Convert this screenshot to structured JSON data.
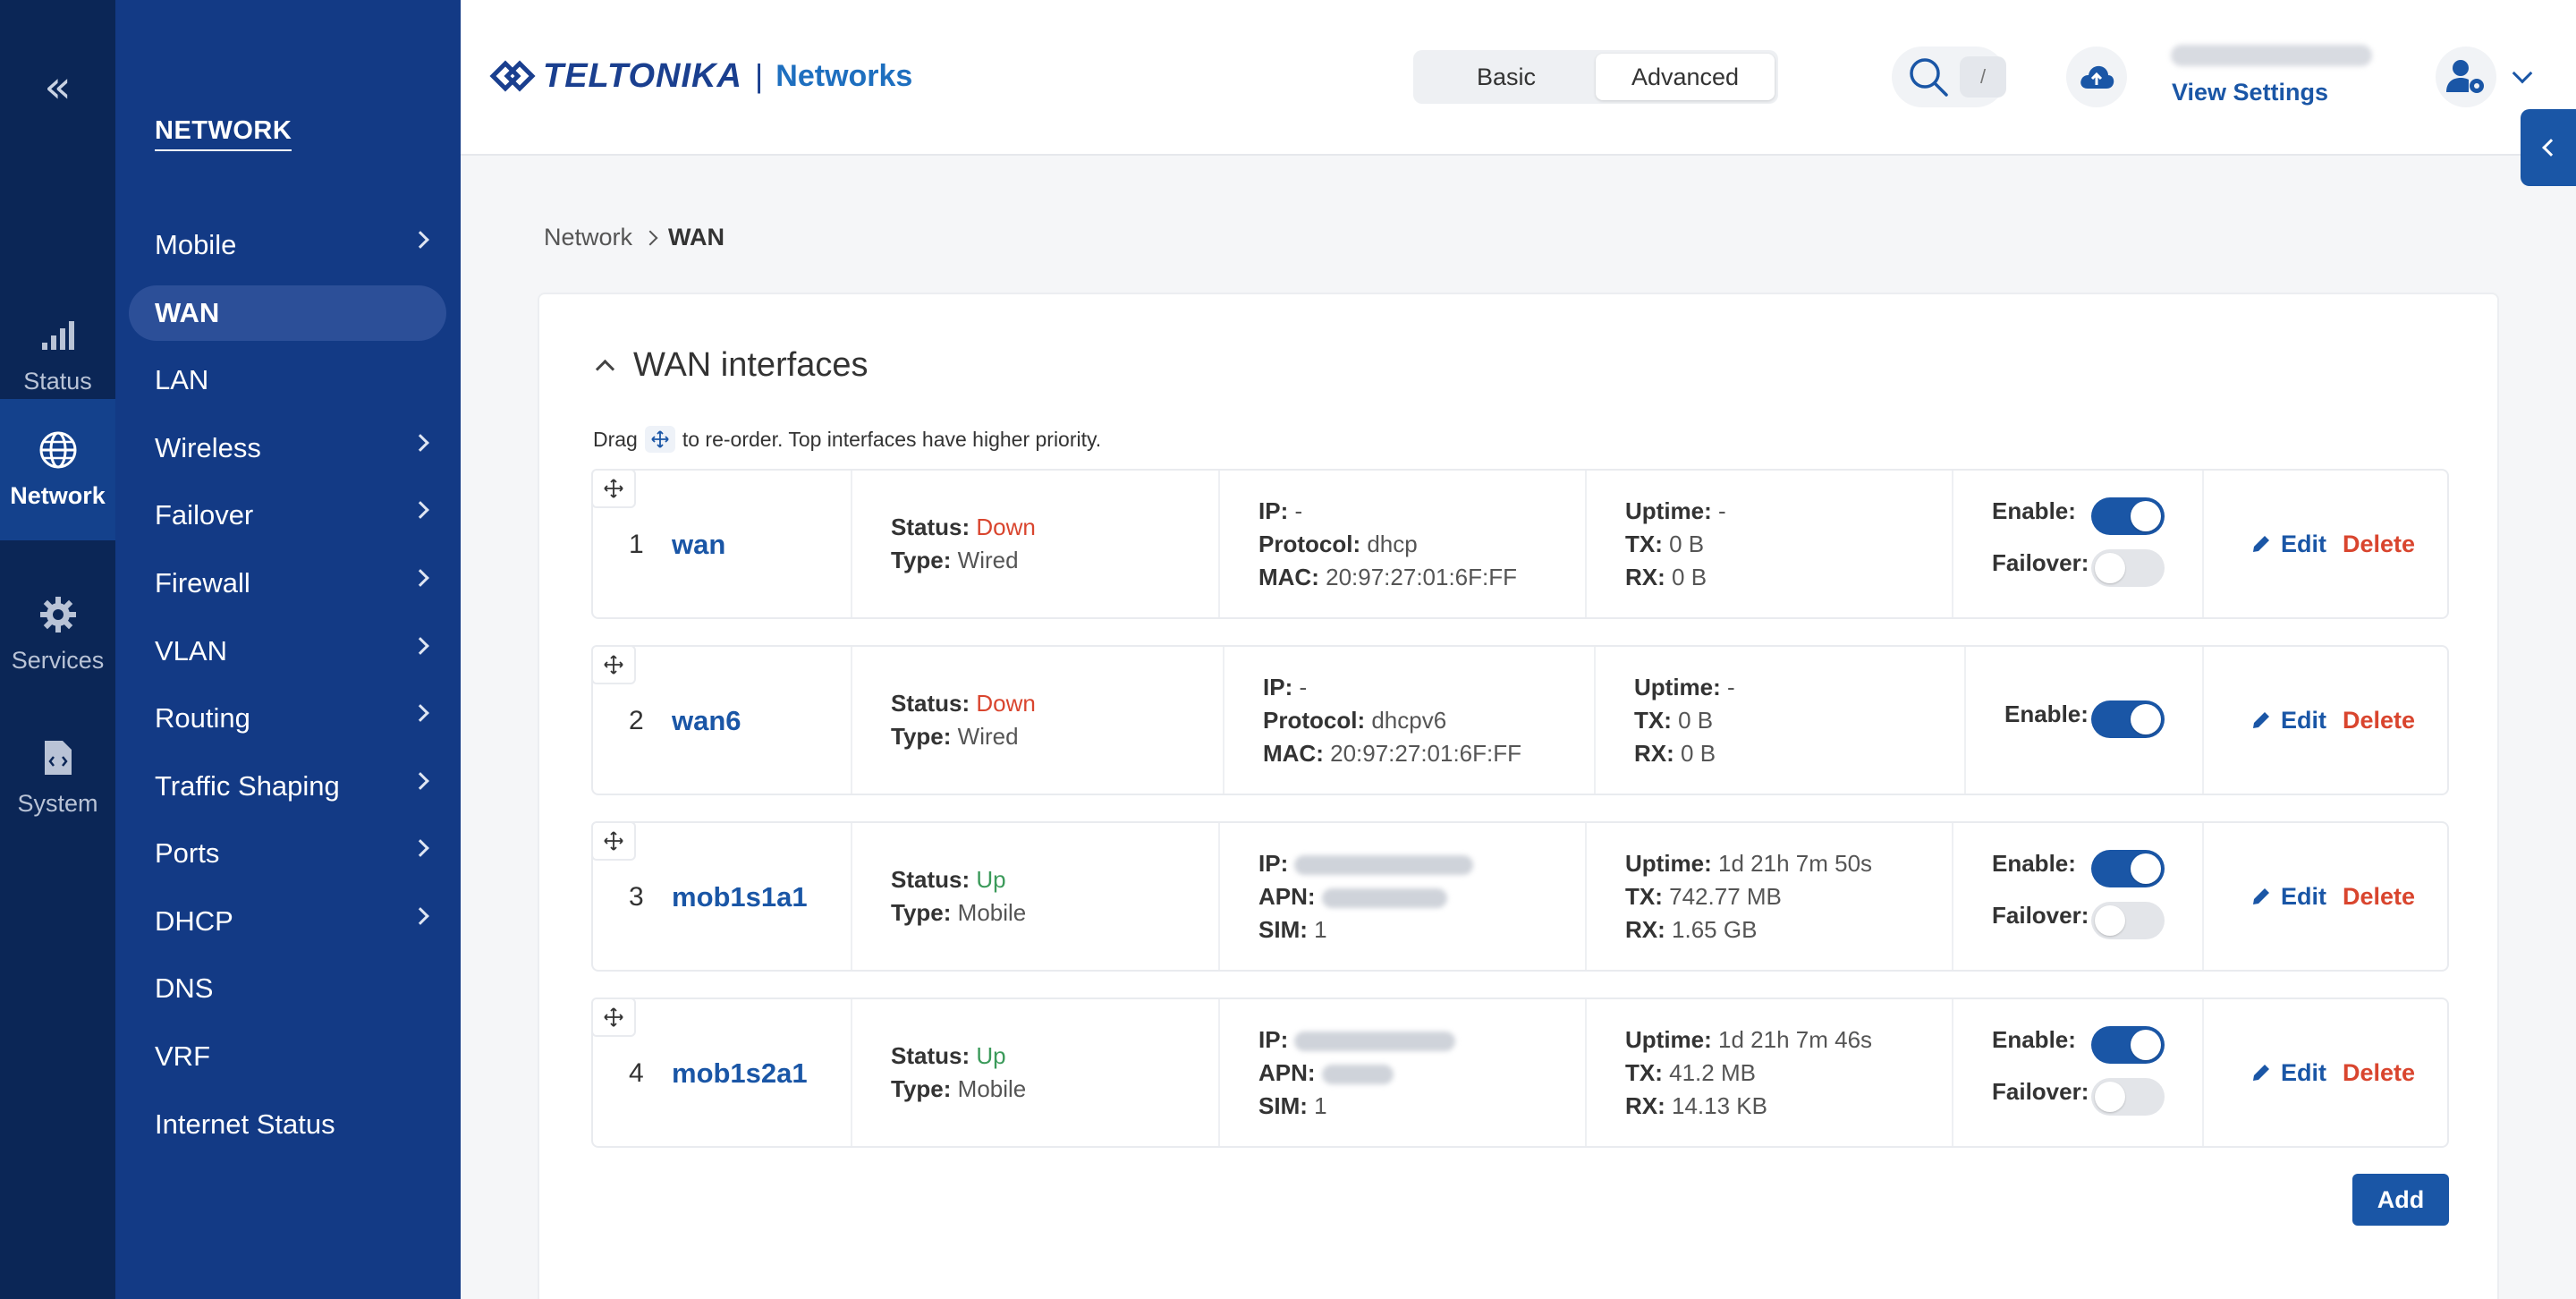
{
  "rail": {
    "collapse_glyph": "«",
    "items": [
      {
        "label": "Status"
      },
      {
        "label": "Network"
      },
      {
        "label": "Services"
      },
      {
        "label": "System"
      }
    ]
  },
  "subnav": {
    "title": "NETWORK",
    "items": [
      {
        "label": "Mobile"
      },
      {
        "label": "WAN"
      },
      {
        "label": "LAN"
      },
      {
        "label": "Wireless"
      },
      {
        "label": "Failover"
      },
      {
        "label": "Firewall"
      },
      {
        "label": "VLAN"
      },
      {
        "label": "Routing"
      },
      {
        "label": "Traffic Shaping"
      },
      {
        "label": "Ports"
      },
      {
        "label": "DHCP"
      },
      {
        "label": "DNS"
      },
      {
        "label": "VRF"
      },
      {
        "label": "Internet Status"
      }
    ]
  },
  "header": {
    "logo_word": "TELTONIKA",
    "logo_sep": "|",
    "logo_sub": "Networks",
    "mode_basic": "Basic",
    "mode_advanced": "Advanced",
    "search_shortcut": "/",
    "view_settings": "View Settings"
  },
  "breadcrumb": {
    "root": "Network",
    "current": "WAN"
  },
  "section": {
    "title": "WAN interfaces",
    "hint_before": "Drag",
    "hint_after": "to re-order. Top interfaces have higher priority.",
    "add_label": "Add"
  },
  "labels": {
    "status": "Status:",
    "type": "Type:",
    "ip": "IP:",
    "protocol": "Protocol:",
    "mac": "MAC:",
    "apn": "APN:",
    "sim": "SIM:",
    "uptime": "Uptime:",
    "tx": "TX:",
    "rx": "RX:",
    "enable": "Enable:",
    "failover": "Failover:",
    "edit": "Edit",
    "delete": "Delete"
  },
  "interfaces": [
    {
      "num": "1",
      "name": "wan",
      "status": "Down",
      "type": "Wired",
      "ip": "-",
      "protocol": "dhcp",
      "mac": "20:97:27:01:6F:FF",
      "uptime": "-",
      "tx": "0 B",
      "rx": "0 B",
      "enable": true,
      "failover": false
    },
    {
      "num": "2",
      "name": "wan6",
      "status": "Down",
      "type": "Wired",
      "ip": "-",
      "protocol": "dhcpv6",
      "mac": "20:97:27:01:6F:FF",
      "uptime": "-",
      "tx": "0 B",
      "rx": "0 B",
      "enable": true
    },
    {
      "num": "3",
      "name": "mob1s1a1",
      "status": "Up",
      "type": "Mobile",
      "sim": "1",
      "uptime": "1d 21h 7m 50s",
      "tx": "742.77 MB",
      "rx": "1.65 GB",
      "enable": true,
      "failover": false
    },
    {
      "num": "4",
      "name": "mob1s2a1",
      "status": "Up",
      "type": "Mobile",
      "sim": "1",
      "uptime": "1d 21h 7m 46s",
      "tx": "41.2 MB",
      "rx": "14.13 KB",
      "enable": true,
      "failover": false
    }
  ],
  "colors": {
    "primary": "#1a56a6",
    "sidebar": "#133a85",
    "rail": "#0b2656",
    "down": "#d9452e",
    "up": "#3b9a5a"
  }
}
